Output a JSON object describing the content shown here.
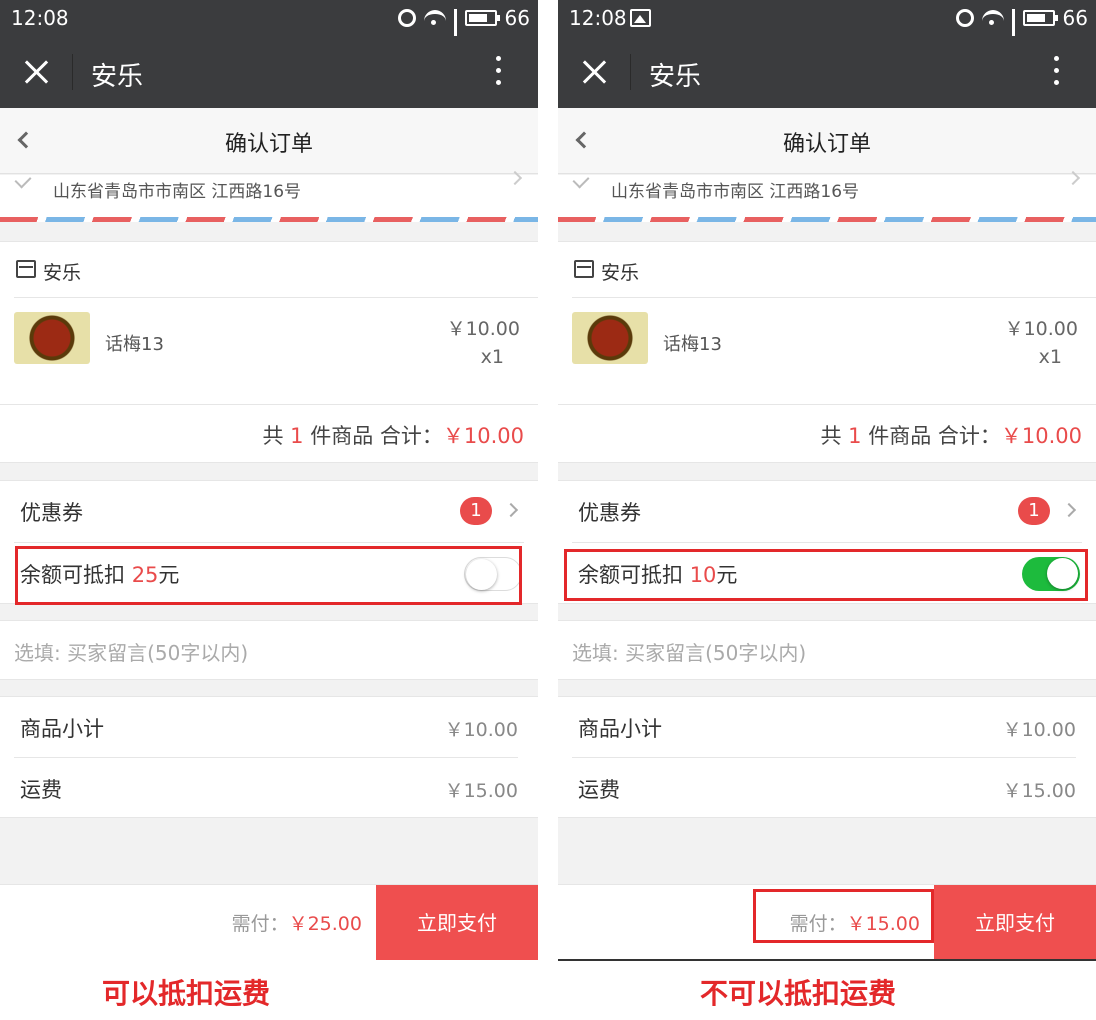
{
  "screens": [
    {
      "status": {
        "time": "12:08",
        "battery": "66"
      },
      "window_title": "安乐",
      "nav_title": "确认订单",
      "address": "山东省青岛市市南区 江西路16号",
      "shop": {
        "name": "安乐",
        "product_name": "话梅13",
        "price": "￥10.00",
        "quantity": "x1",
        "summary_prefix": "共 ",
        "summary_count": "1",
        "summary_middle": " 件商品 合计：",
        "summary_total": "￥10.00"
      },
      "coupon": {
        "label": "优惠券",
        "badge": "1"
      },
      "balance": {
        "label": "余额可抵扣 ",
        "amount": "25",
        "unit": "元",
        "toggle_on": false
      },
      "memo_placeholder": "选填: 买家留言(50字以内)",
      "costs": [
        {
          "label": "商品小计",
          "value": "￥10.00"
        },
        {
          "label": "运费",
          "value": "￥15.00"
        }
      ],
      "footer": {
        "due_label": "需付：",
        "due_amount": "￥25.00",
        "pay_button": "立即支付"
      },
      "caption": "可以抵扣运费"
    },
    {
      "status": {
        "time": "12:08",
        "battery": "66"
      },
      "window_title": "安乐",
      "nav_title": "确认订单",
      "address": "山东省青岛市市南区 江西路16号",
      "shop": {
        "name": "安乐",
        "product_name": "话梅13",
        "price": "￥10.00",
        "quantity": "x1",
        "summary_prefix": "共 ",
        "summary_count": "1",
        "summary_middle": " 件商品 合计：",
        "summary_total": "￥10.00"
      },
      "coupon": {
        "label": "优惠券",
        "badge": "1"
      },
      "balance": {
        "label": "余额可抵扣 ",
        "amount": "10",
        "unit": "元",
        "toggle_on": true
      },
      "memo_placeholder": "选填: 买家留言(50字以内)",
      "costs": [
        {
          "label": "商品小计",
          "value": "￥10.00"
        },
        {
          "label": "运费",
          "value": "￥15.00"
        }
      ],
      "footer": {
        "due_label": "需付：",
        "due_amount": "￥15.00",
        "pay_button": "立即支付"
      },
      "caption": "不可以抵扣运费"
    }
  ],
  "colors": {
    "accent_red": "#e94b4b",
    "toggle_green": "#1dbb3d",
    "annotation_red": "#e3282a",
    "header_dark": "#3b3c3e"
  },
  "icons": [
    "close-icon",
    "more-icon",
    "back-icon",
    "location-pin-icon",
    "shop-icon",
    "chevron-right-icon",
    "alarm-icon",
    "wifi-icon",
    "signal-icon",
    "battery-icon",
    "image-icon"
  ]
}
